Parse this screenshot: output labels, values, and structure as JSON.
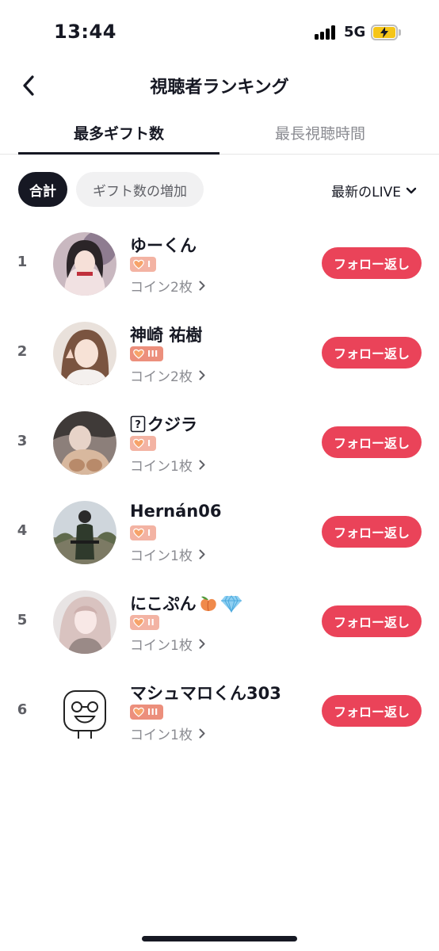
{
  "status_bar": {
    "time": "13:44",
    "network": "5G"
  },
  "header": {
    "title": "視聴者ランキング"
  },
  "tabs": [
    {
      "label": "最多ギフト数",
      "active": true
    },
    {
      "label": "最長視聴時間",
      "active": false
    }
  ],
  "filters": {
    "chips": [
      {
        "label": "合計",
        "active": true
      },
      {
        "label": "ギフト数の増加",
        "active": false
      }
    ],
    "live_select": "最新のLIVE"
  },
  "viewers": [
    {
      "rank": "1",
      "name": "ゆーくん",
      "level": "I",
      "coins": "コイン2枚",
      "follow_label": "フォロー返し"
    },
    {
      "rank": "2",
      "name": "神崎 祐樹",
      "level": "III",
      "coins": "コイン2枚",
      "follow_label": "フォロー返し"
    },
    {
      "rank": "3",
      "name": "クジラ",
      "level": "I",
      "coins": "コイン1枚",
      "follow_label": "フォロー返し"
    },
    {
      "rank": "4",
      "name": "Hernán06",
      "level": "I",
      "coins": "コイン1枚",
      "follow_label": "フォロー返し"
    },
    {
      "rank": "5",
      "name": "にこぷん",
      "level": "II",
      "coins": "コイン1枚",
      "follow_label": "フォロー返し"
    },
    {
      "rank": "6",
      "name": "マシュマロくん303",
      "level": "III",
      "coins": "コイン1枚",
      "follow_label": "フォロー返し"
    }
  ],
  "colors": {
    "accent": "#ea4359",
    "badge_light": "#f3b3a3",
    "badge_dark": "#ec8f7c",
    "text_secondary": "#8a8b91"
  }
}
